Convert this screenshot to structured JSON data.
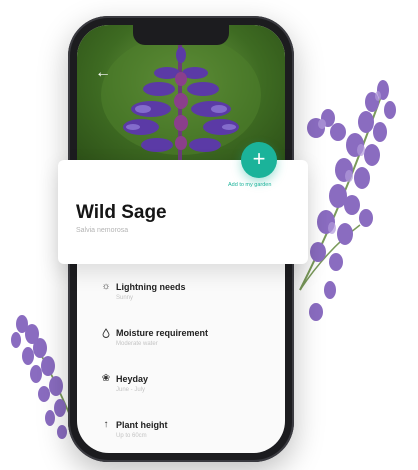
{
  "screen": {
    "back_icon": "arrow-left-icon",
    "plant": {
      "name": "Wild Sage",
      "latin_name": "Salvia nemorosa"
    },
    "add_button": {
      "icon": "plus-icon",
      "caption": "Add to my garden"
    },
    "carousel": {
      "count": 3,
      "active_index": 1
    },
    "info_rows": [
      {
        "icon": "sun-icon",
        "label": "Lightning needs",
        "value": "Sunny"
      },
      {
        "icon": "droplet-icon",
        "label": "Moisture requirement",
        "value": "Moderate water"
      },
      {
        "icon": "flower-icon",
        "label": "Heyday",
        "value": "June - July"
      },
      {
        "icon": "arrow-up-icon",
        "label": "Plant height",
        "value": "Up to 60cm"
      }
    ]
  },
  "colors": {
    "accent": "#1bb39a",
    "lavender": "#8a6cc0",
    "flower_purple": "#5b3aa6",
    "leaf_green": "#5a8f34"
  }
}
